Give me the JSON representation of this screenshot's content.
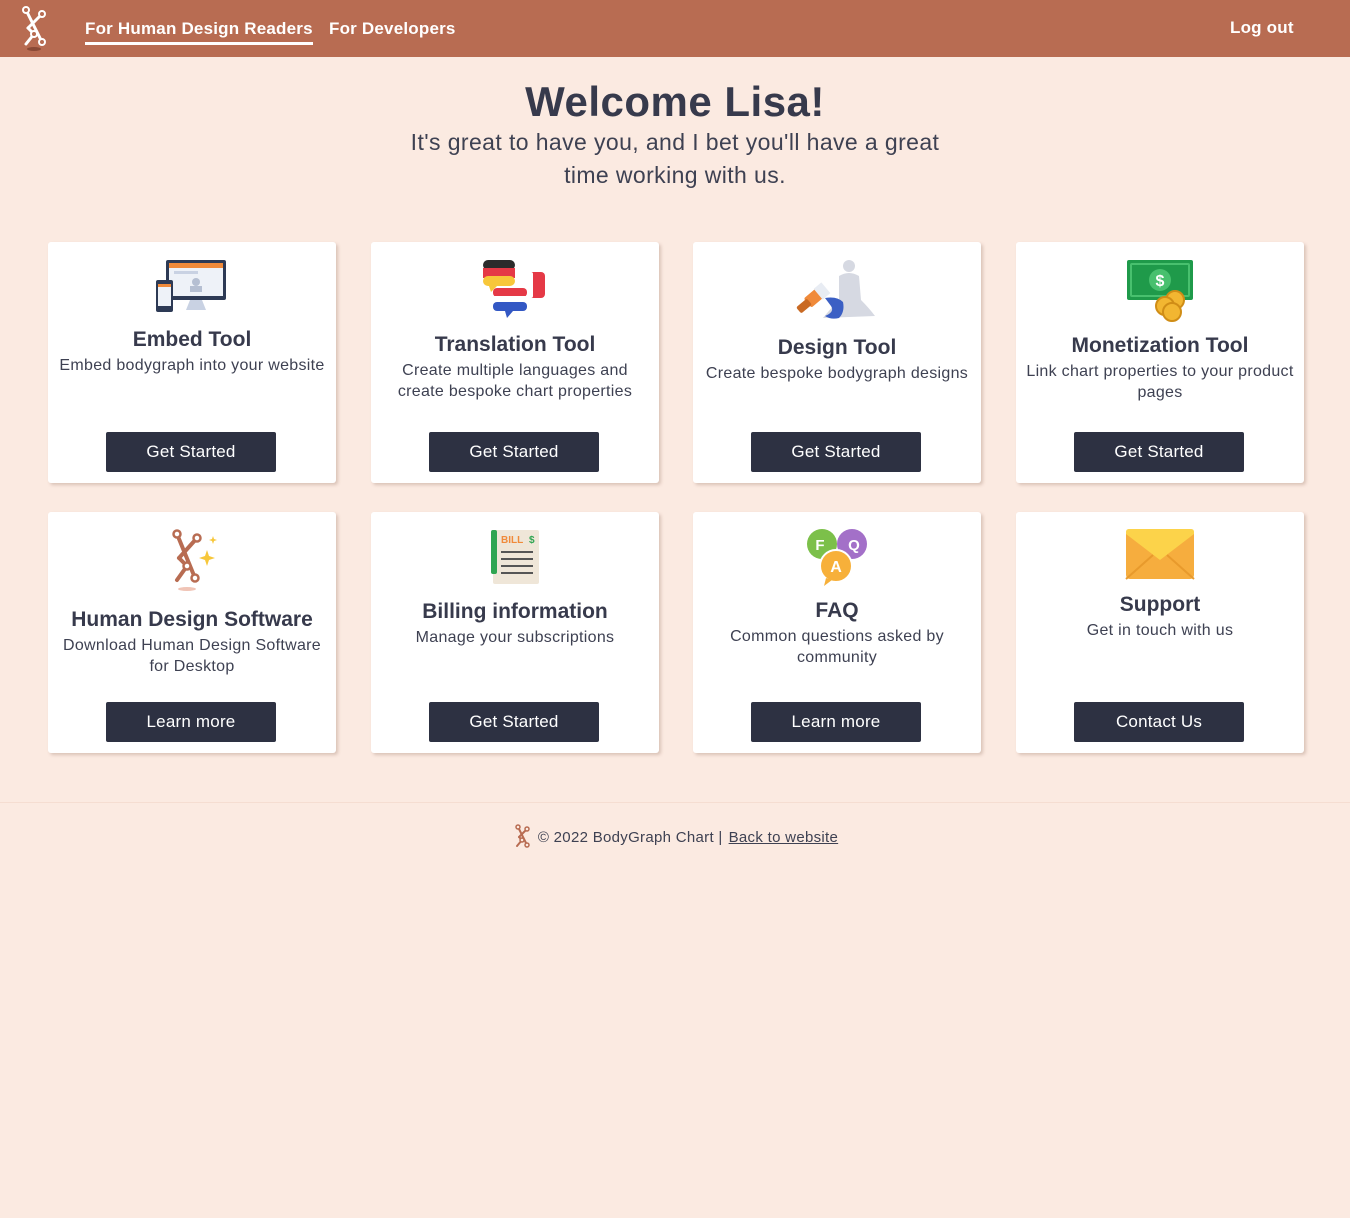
{
  "nav": {
    "links": [
      "For Human Design Readers",
      "For Developers"
    ],
    "logout": "Log out",
    "logo_icon": "bodygraph-logo-icon",
    "active_link": "For Human Design Readers"
  },
  "hero": {
    "title": "Welcome Lisa!",
    "subtitle": "It's great to have you, and I bet you'll have a great time working with us."
  },
  "cards": [
    {
      "icon": "embed-devices-icon",
      "title": "Embed Tool",
      "desc": "Embed bodygraph into your website",
      "button": "Get Started"
    },
    {
      "icon": "translation-flags-icon",
      "title": "Translation Tool",
      "desc": "Create multiple languages and create bespoke chart properties",
      "button": "Get Started"
    },
    {
      "icon": "design-brush-icon",
      "title": "Design Tool",
      "desc": "Create bespoke bodygraph designs",
      "button": "Get Started"
    },
    {
      "icon": "money-coins-icon",
      "title": "Monetization Tool",
      "desc": "Link chart properties to your product pages",
      "button": "Get Started"
    },
    {
      "icon": "human-design-software-icon",
      "title": "Human Design Software",
      "desc": "Download Human Design Software for Desktop",
      "button": "Learn more"
    },
    {
      "icon": "bill-receipt-icon",
      "title": "Billing information",
      "desc": "Manage your subscriptions",
      "button": "Get Started"
    },
    {
      "icon": "faq-bubbles-icon",
      "title": "FAQ",
      "desc": "Common questions asked by community",
      "button": "Learn more"
    },
    {
      "icon": "envelope-icon",
      "title": "Support",
      "desc": "Get in touch with us",
      "button": "Contact Us"
    }
  ],
  "footer": {
    "copyright": "© 2022 BodyGraph Chart |",
    "link": "Back to website"
  },
  "colors": {
    "navbar": "#b86c52",
    "background": "#fbeae1",
    "button": "#2d3142",
    "text": "#373a4c"
  }
}
